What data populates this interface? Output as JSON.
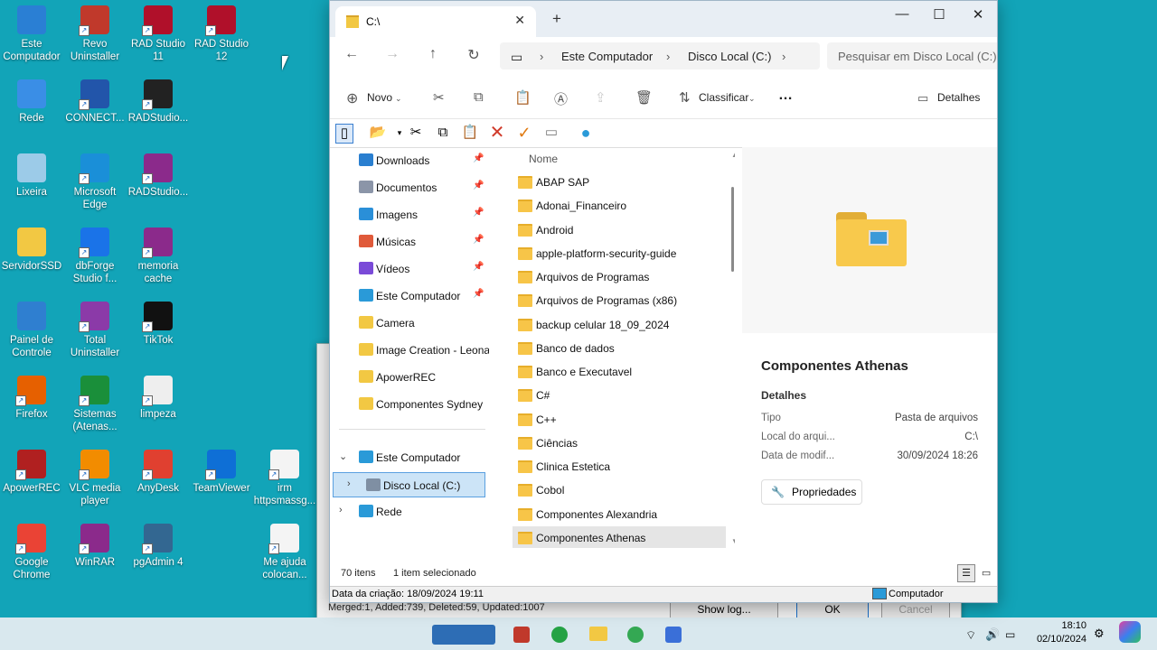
{
  "desktop": {
    "icons": [
      {
        "label": "Este\nComputador",
        "color": "#2a7fd4"
      },
      {
        "label": "Revo\nUninstaller",
        "color": "#c0392b"
      },
      {
        "label": "RAD Studio\n11",
        "color": "#b0102a"
      },
      {
        "label": "RAD Studio\n12",
        "color": "#b0102a"
      },
      {
        "label": "Rede",
        "color": "#3a8ee6"
      },
      {
        "label": "CONNECT...",
        "color": "#2255aa"
      },
      {
        "label": "RADStudio...",
        "color": "#222222"
      },
      {
        "label": "Lixeira",
        "color": "#9ccbe8"
      },
      {
        "label": "Microsoft\nEdge",
        "color": "#1a8fd8"
      },
      {
        "label": "RADStudio...",
        "color": "#8b2a8b"
      },
      {
        "label": "ServidorSSD",
        "color": "#f2c843"
      },
      {
        "label": "dbForge\nStudio f...",
        "color": "#1a73e8"
      },
      {
        "label": "memoria\ncache",
        "color": "#8b2a8b"
      },
      {
        "label": "Painel de\nControle",
        "color": "#2f7fd0"
      },
      {
        "label": "Total\nUninstaller",
        "color": "#8b3aa8"
      },
      {
        "label": "TikTok",
        "color": "#111111"
      },
      {
        "label": "Firefox",
        "color": "#e66000"
      },
      {
        "label": "Sistemas\n(Atenas...",
        "color": "#1a8f3a"
      },
      {
        "label": "limpeza",
        "color": "#eeeeee"
      },
      {
        "label": "ApowerREC",
        "color": "#b02020"
      },
      {
        "label": "VLC media\nplayer",
        "color": "#f28c00"
      },
      {
        "label": "AnyDesk",
        "color": "#e04030"
      },
      {
        "label": "TeamViewer",
        "color": "#0e6fd6"
      },
      {
        "label": "irm\nhttpsmassg...",
        "color": "#f4f4f4"
      },
      {
        "label": "Google\nChrome",
        "color": "#ea4335"
      },
      {
        "label": "WinRAR",
        "color": "#8b2a8b"
      },
      {
        "label": "pgAdmin 4",
        "color": "#336791"
      },
      {
        "label": "Me ajuda\ncolocan...",
        "color": "#f4f4f4"
      }
    ]
  },
  "bg_dialog": {
    "status": "Merged:1, Added:739, Deleted:59, Updated:1007",
    "show_log": "Show log...",
    "ok": "OK",
    "cancel": "Cancel"
  },
  "taskbar": {
    "time": "18:10",
    "date": "02/10/2024"
  },
  "explorer": {
    "tab_title": "C:\\",
    "add_tab": "+",
    "breadcrumbs": [
      "Este Computador",
      "Disco Local (C:)"
    ],
    "search_placeholder": "Pesquisar em Disco Local (C:)",
    "cmd": {
      "new": "Novo",
      "sort": "Classificar",
      "more": "…",
      "details": "Detalhes"
    },
    "nav": [
      {
        "label": "Downloads",
        "icon": "download",
        "pinned": true
      },
      {
        "label": "Documentos",
        "icon": "document",
        "pinned": true
      },
      {
        "label": "Imagens",
        "icon": "image",
        "pinned": true
      },
      {
        "label": "Músicas",
        "icon": "music",
        "pinned": true
      },
      {
        "label": "Vídeos",
        "icon": "video",
        "pinned": true
      },
      {
        "label": "Este Computador",
        "icon": "computer",
        "pinned": true
      },
      {
        "label": "Camera",
        "icon": "folder",
        "pinned": false
      },
      {
        "label": "Image Creation - Leonardo",
        "icon": "folder",
        "pinned": false
      },
      {
        "label": "ApowerREC",
        "icon": "folder",
        "pinned": false
      },
      {
        "label": "Componentes Sydney",
        "icon": "folder",
        "pinned": false
      }
    ],
    "tree": [
      {
        "label": "Este Computador",
        "expanded": true
      },
      {
        "label": "Disco Local (C:)",
        "selected": true
      },
      {
        "label": "Rede"
      }
    ],
    "files_header": "Nome",
    "files": [
      "ABAP SAP",
      "Adonai_Financeiro",
      "Android",
      "apple-platform-security-guide",
      "Arquivos de Programas",
      "Arquivos de Programas (x86)",
      "backup celular 18_09_2024",
      "Banco de dados",
      "Banco e Executavel",
      "C#",
      "C++",
      "Ciências",
      "Clinica Estetica",
      "Cobol",
      "Componentes Alexandria",
      "Componentes Athenas"
    ],
    "selected_file": "Componentes Athenas",
    "details": {
      "name": "Componentes Athenas",
      "section": "Detalhes",
      "props": [
        {
          "k": "Tipo",
          "v": "Pasta de arquivos"
        },
        {
          "k": "Local do arqui...",
          "v": "C:\\"
        },
        {
          "k": "Data de modif...",
          "v": "30/09/2024 18:26"
        }
      ],
      "properties_button": "Propriedades"
    },
    "status": {
      "count": "70 itens",
      "selected": "1 item selecionado"
    },
    "legacy_status": {
      "created": "Data da criação: 18/09/2024 19:11",
      "location": "Computador"
    }
  }
}
